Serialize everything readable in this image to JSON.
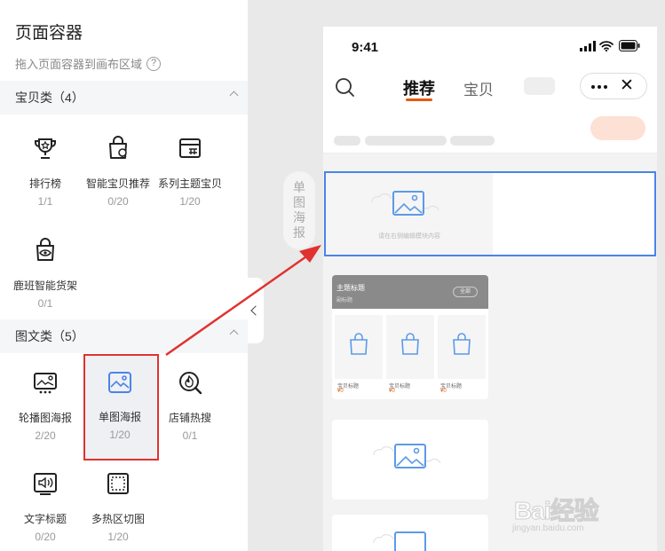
{
  "panel": {
    "title": "页面容器",
    "subtitle": "拖入页面容器到画布区域",
    "help_glyph": "?"
  },
  "categories": [
    {
      "label": "宝贝类（4）",
      "items": [
        {
          "name": "排行榜",
          "count": "1/1",
          "icon": "trophy-icon"
        },
        {
          "name": "智能宝贝推荐",
          "count": "0/20",
          "icon": "smart-bag-icon"
        },
        {
          "name": "系列主题宝贝",
          "count": "1/20",
          "icon": "store-series-icon"
        },
        {
          "name": "鹿班智能货架",
          "count": "0/1",
          "icon": "smart-shelf-icon"
        }
      ]
    },
    {
      "label": "图文类（5）",
      "items": [
        {
          "name": "轮播图海报",
          "count": "2/20",
          "icon": "carousel-icon"
        },
        {
          "name": "单图海报",
          "count": "1/20",
          "icon": "image-poster-icon"
        },
        {
          "name": "店铺热搜",
          "count": "0/1",
          "icon": "hot-search-icon"
        },
        {
          "name": "文字标题",
          "count": "0/20",
          "icon": "text-title-icon"
        },
        {
          "name": "多热区切图",
          "count": "1/20",
          "icon": "hotzone-icon"
        }
      ]
    }
  ],
  "drag_hint": {
    "text": "单\n图\n海\n报"
  },
  "phone": {
    "time": "9:41",
    "tabs": [
      "推荐",
      "宝贝"
    ],
    "close_glyph": "✕",
    "selected_placeholder": "请在右侧编辑模块内容",
    "theme_card": {
      "title": "主题标题",
      "subtitle": "副标题",
      "all_label": "全部",
      "products": [
        {
          "name": "宝贝标题",
          "price": "¥0"
        },
        {
          "name": "宝贝标题",
          "price": "¥0"
        },
        {
          "name": "宝贝标题",
          "price": "¥0"
        }
      ]
    }
  },
  "watermark": {
    "main": "Bai经验",
    "sub": "jingyan.baidu.com"
  },
  "colors": {
    "accent_blue": "#4a84e8",
    "highlight_red": "#e0322f",
    "tab_orange": "#e8590c"
  }
}
